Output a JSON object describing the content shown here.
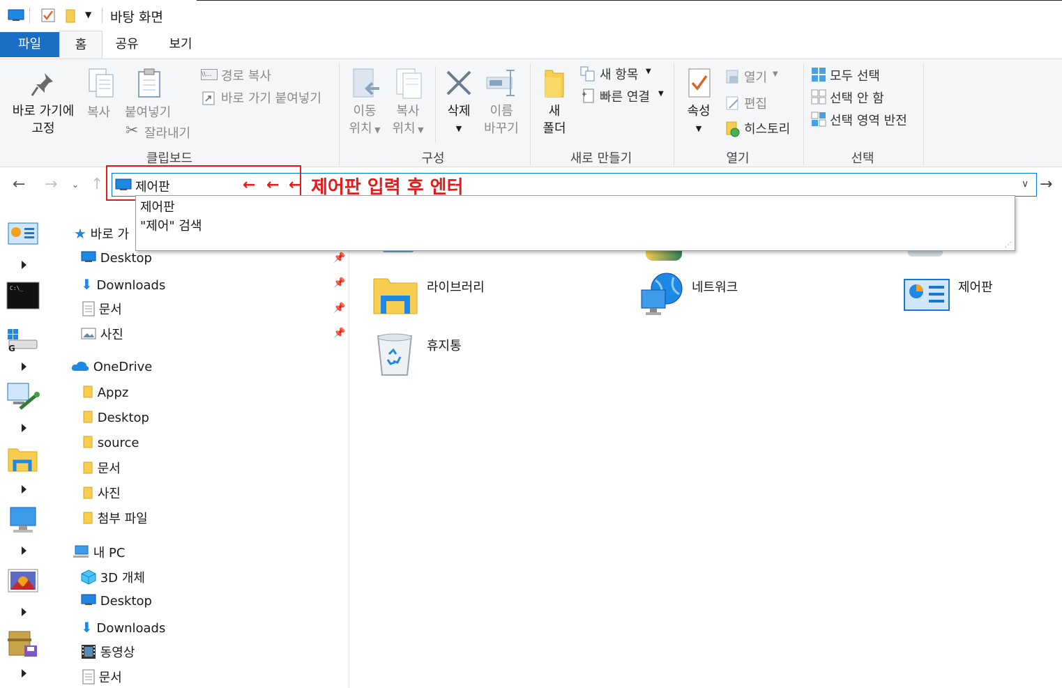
{
  "window": {
    "title": "바탕 화면"
  },
  "tabs": [
    "파일",
    "홈",
    "공유",
    "보기"
  ],
  "ribbon": {
    "clipboard": {
      "group": "클립보드",
      "pin_line1": "바로 가기에",
      "pin_line2": "고정",
      "copy": "복사",
      "paste": "붙여넣기",
      "copy_path": "경로 복사",
      "paste_shortcut": "바로 가기 붙여넣기",
      "cut": "잘라내기"
    },
    "organize": {
      "group": "구성",
      "move_line1": "이동",
      "move_line2": "위치",
      "copyto_line1": "복사",
      "copyto_line2": "위치",
      "delete": "삭제",
      "rename_line1": "이름",
      "rename_line2": "바꾸기"
    },
    "new": {
      "group": "새로 만들기",
      "folder_line1": "새",
      "folder_line2": "폴더",
      "new_item": "새 항목",
      "easy_access": "빠른 연결"
    },
    "open": {
      "group": "열기",
      "properties": "속성",
      "open": "열기",
      "edit": "편집",
      "history": "히스토리"
    },
    "select": {
      "group": "선택",
      "select_all": "모두 선택",
      "select_none": "선택 안 함",
      "invert": "선택 영역 반전"
    }
  },
  "address": {
    "value": "제어판",
    "annotation": "제어판 입력 후 엔터",
    "suggestions": [
      "제어판",
      "\"제어\" 검색"
    ]
  },
  "nav": {
    "quick_access": "바로 가",
    "quick_items": [
      "Desktop",
      "Downloads",
      "문서",
      "사진"
    ],
    "onedrive": "OneDrive",
    "onedrive_items": [
      "Appz",
      "Desktop",
      "source",
      "문서",
      "사진",
      "첨부 파일"
    ],
    "this_pc": "내 PC",
    "pc_items": [
      "3D 개체",
      "Desktop",
      "Downloads",
      "동영상",
      "문서"
    ]
  },
  "content": {
    "items": [
      "라이브러리",
      "네트워크",
      "제어판",
      "휴지통"
    ]
  },
  "colors": {
    "accent": "#1a6ec6",
    "annotation": "#e31b1b",
    "folder": "#f7cd52"
  }
}
